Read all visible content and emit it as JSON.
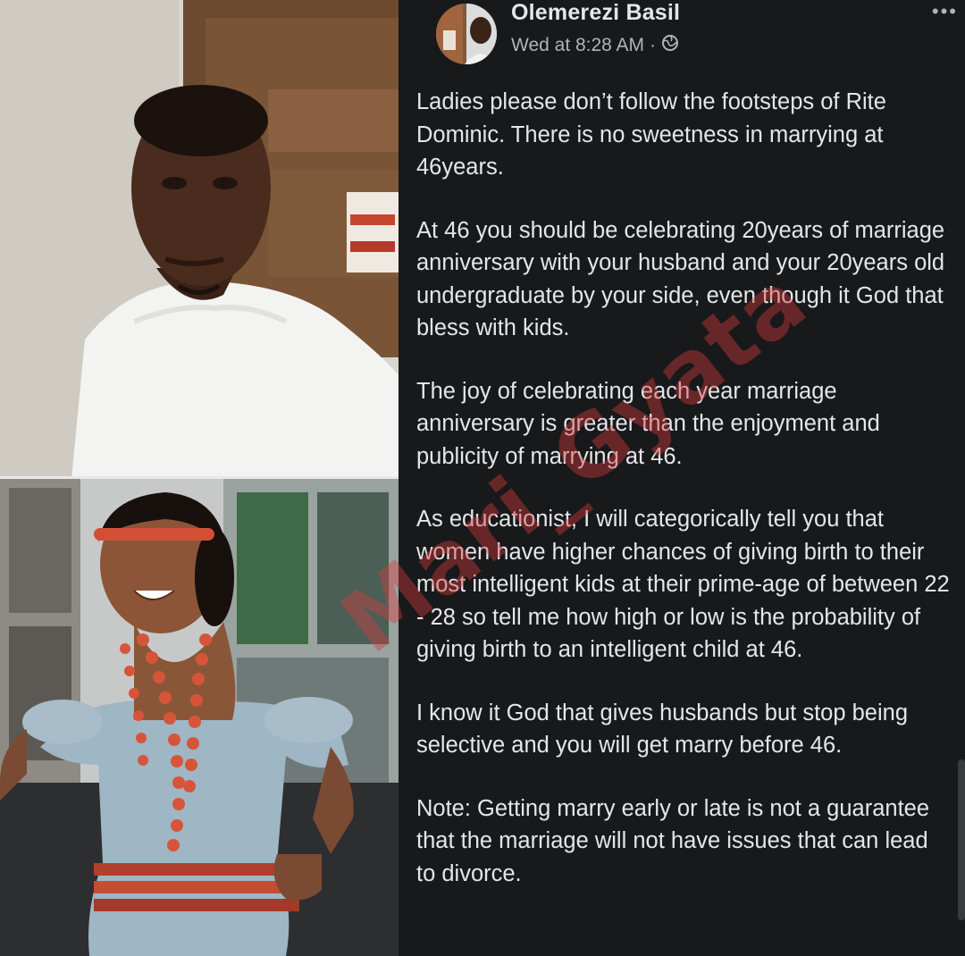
{
  "post": {
    "author": "Olemerezi Basil",
    "timestamp": "Wed at 8:28 AM",
    "separator": "·",
    "privacy_icon": "globe-icon",
    "more_icon": "more-options-icon",
    "paragraphs": [
      "Ladies please don’t follow the footsteps of Rite Dominic. There is no sweetness in marrying at 46years.",
      "At 46 you should be celebrating 20years of marriage anniversary with your husband and your 20years old undergraduate by your side, even though it God that bless with kids.",
      "The joy of celebrating each year marriage anniversary is greater than the enjoyment and publicity of marrying at 46.",
      "As educationist, I will categorically tell you that women have higher chances of giving birth to their most intelligent kids at their prime-age of between 22 - 28 so tell me how high or low is the probability of giving birth to an intelligent child at 46.",
      "I know it God that gives husbands but stop being selective and you will get marry before 46.",
      "Note: Getting marry early or late is not a guarantee that the marriage will not have issues that can lead to divorce."
    ]
  },
  "watermark": "Mari_Gyata",
  "photos": {
    "top_alt": "man in white shirt selfie",
    "bottom_alt": "woman in coral bead traditional attire"
  }
}
